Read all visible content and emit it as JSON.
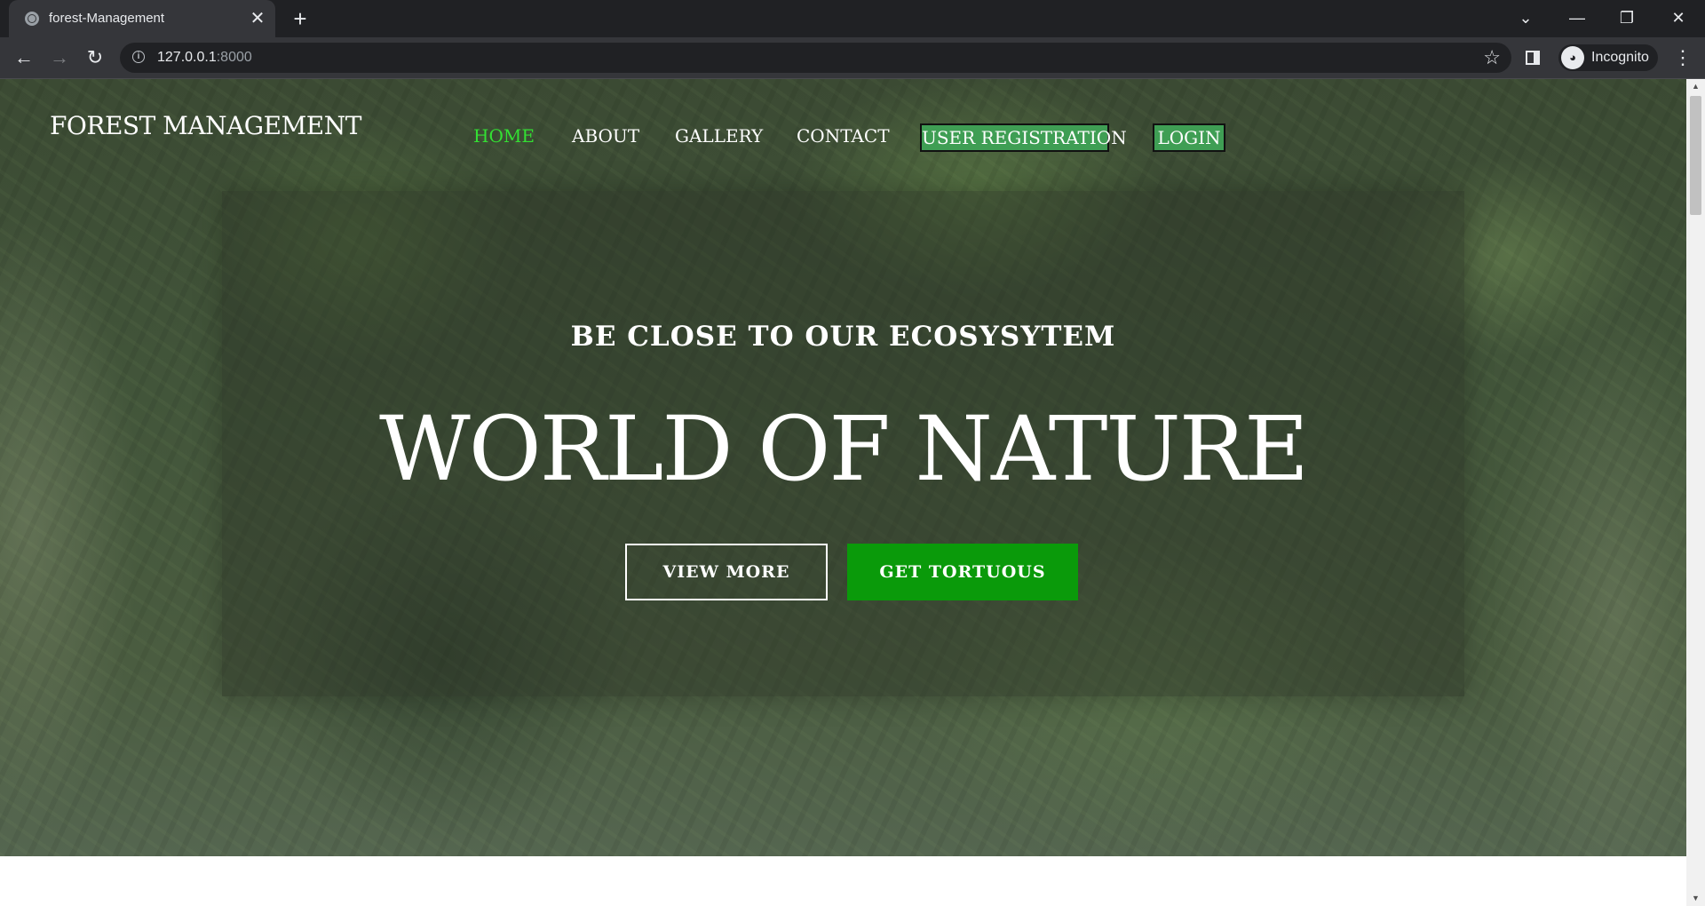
{
  "browser": {
    "tab_title": "forest-Management",
    "url_host": "127.0.0.1",
    "url_port": ":8000",
    "profile_label": "Incognito"
  },
  "site": {
    "brand": "FOREST MANAGEMENT",
    "nav": {
      "home": "HOME",
      "about": "ABOUT",
      "gallery": "GALLERY",
      "contact": "CONTACT",
      "user_registration": "USER REGISTRATION",
      "login": "LOGIN"
    },
    "active_nav_color": "#33e033",
    "hero": {
      "tagline": "BE CLOSE TO OUR ECOSYSYTEM",
      "headline": "WORLD OF NATURE",
      "view_more": "VIEW MORE",
      "get_tortuous": "GET TORTUOUS"
    },
    "accent_green": "#0a9a0a",
    "nav_button_green": "#3f9e54"
  }
}
